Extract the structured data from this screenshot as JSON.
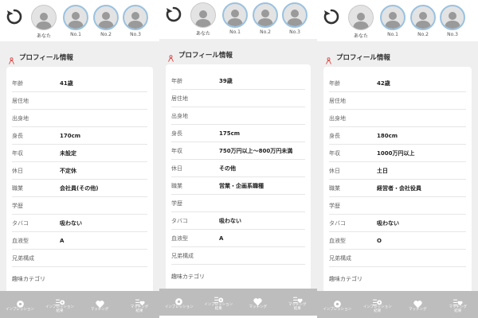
{
  "avatars": [
    "あなた",
    "No.1",
    "No.2",
    "No.3"
  ],
  "section_title": "プロフィール情報",
  "hobby_label": "趣味カテゴリ",
  "nav": [
    {
      "label": "インプレッション"
    },
    {
      "label": "インプレッション",
      "sub": "結果"
    },
    {
      "label": "マッチング"
    },
    {
      "label": "マッチング",
      "sub": "結果"
    }
  ],
  "profiles": [
    {
      "rows": [
        {
          "label": "年齢",
          "value": "41歳"
        },
        {
          "label": "居住地",
          "value": ""
        },
        {
          "label": "出身地",
          "value": ""
        },
        {
          "label": "身長",
          "value": "170cm"
        },
        {
          "label": "年収",
          "value": "未設定"
        },
        {
          "label": "休日",
          "value": "不定休"
        },
        {
          "label": "職業",
          "value": "会社員(その他)"
        },
        {
          "label": "学歴",
          "value": ""
        },
        {
          "label": "タバコ",
          "value": "吸わない"
        },
        {
          "label": "血液型",
          "value": "A"
        },
        {
          "label": "兄弟構成",
          "value": ""
        }
      ]
    },
    {
      "rows": [
        {
          "label": "年齢",
          "value": "39歳"
        },
        {
          "label": "居住地",
          "value": ""
        },
        {
          "label": "出身地",
          "value": ""
        },
        {
          "label": "身長",
          "value": "175cm"
        },
        {
          "label": "年収",
          "value": "750万円以上～800万円未満"
        },
        {
          "label": "休日",
          "value": "その他"
        },
        {
          "label": "職業",
          "value": "営業・企画系職種"
        },
        {
          "label": "学歴",
          "value": ""
        },
        {
          "label": "タバコ",
          "value": "吸わない"
        },
        {
          "label": "血液型",
          "value": "A"
        },
        {
          "label": "兄弟構成",
          "value": ""
        }
      ]
    },
    {
      "rows": [
        {
          "label": "年齢",
          "value": "42歳"
        },
        {
          "label": "居住地",
          "value": ""
        },
        {
          "label": "出身地",
          "value": ""
        },
        {
          "label": "身長",
          "value": "180cm"
        },
        {
          "label": "年収",
          "value": "1000万円以上"
        },
        {
          "label": "休日",
          "value": "土日"
        },
        {
          "label": "職業",
          "value": "経営者・会社役員"
        },
        {
          "label": "学歴",
          "value": ""
        },
        {
          "label": "タバコ",
          "value": "吸わない"
        },
        {
          "label": "血液型",
          "value": "O"
        },
        {
          "label": "兄弟構成",
          "value": ""
        }
      ]
    }
  ]
}
